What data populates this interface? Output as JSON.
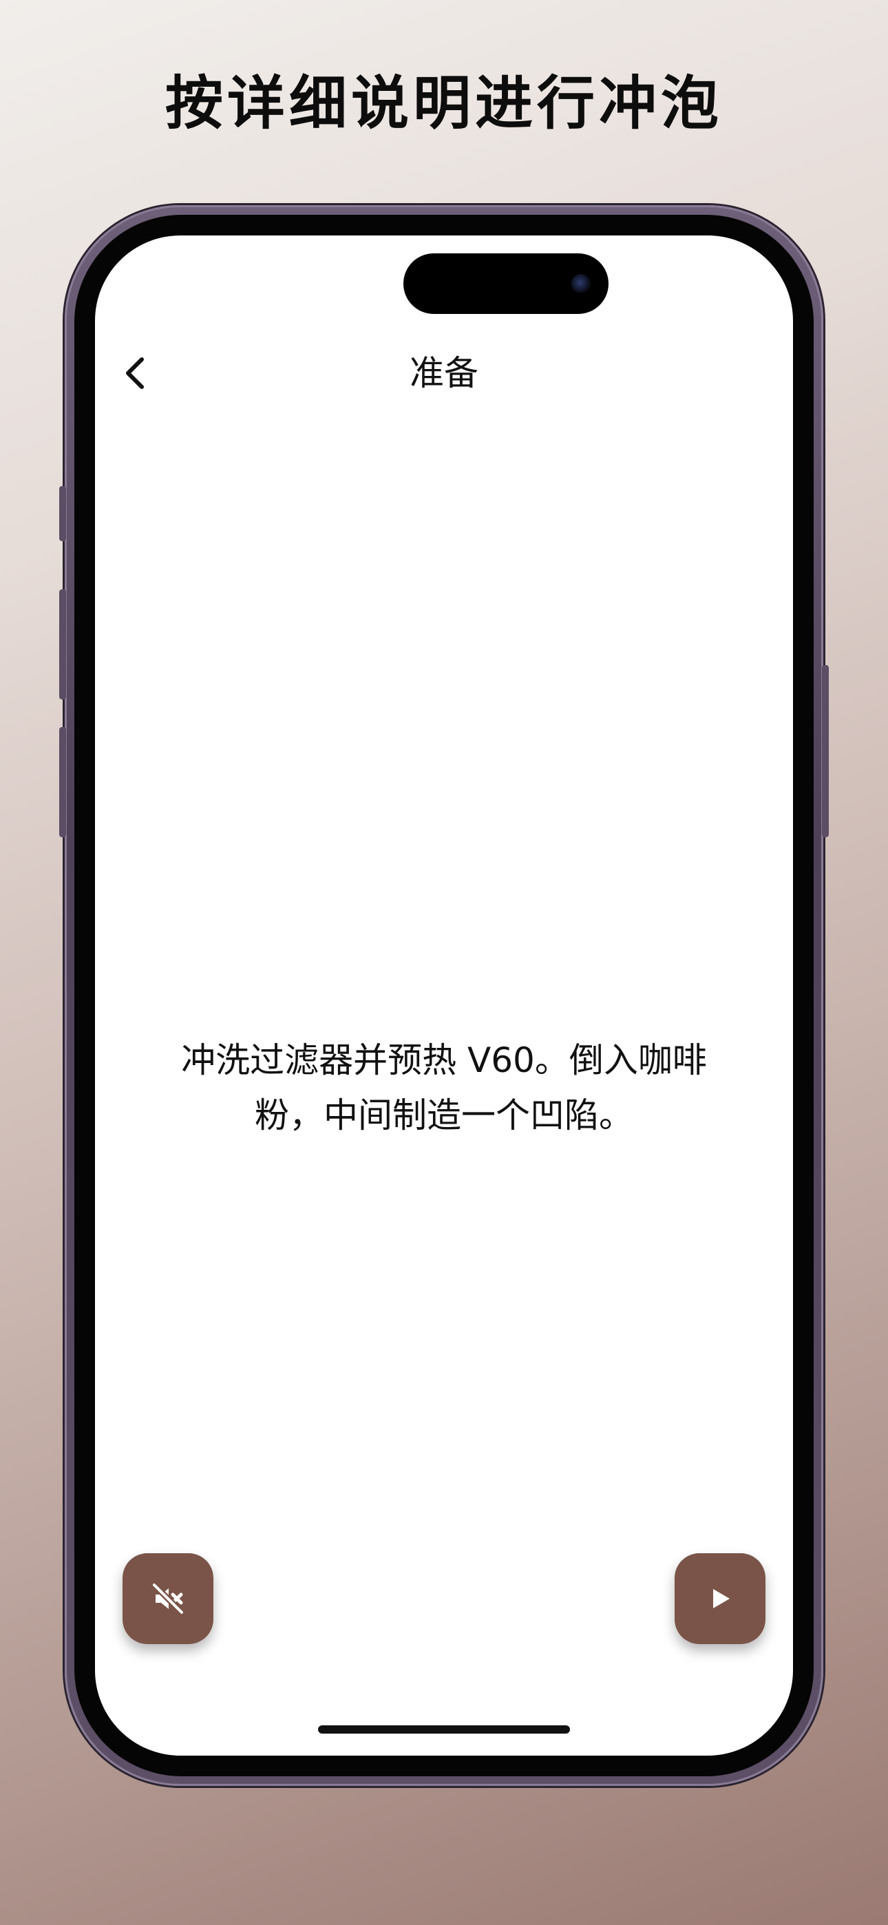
{
  "headline": "按详细说明进行冲泡",
  "nav": {
    "title": "准备",
    "back_icon": "chevron-left-icon"
  },
  "instruction": {
    "line1": "冲洗过滤器并预热 V60。倒入咖啡",
    "line2": "粉，中间制造一个凹陷。"
  },
  "controls": {
    "mute_icon": "speaker-muted-icon",
    "play_icon": "play-icon",
    "button_color": "#7a5448"
  },
  "background_colors": [
    "#f1eeeb",
    "#9a7a72"
  ]
}
